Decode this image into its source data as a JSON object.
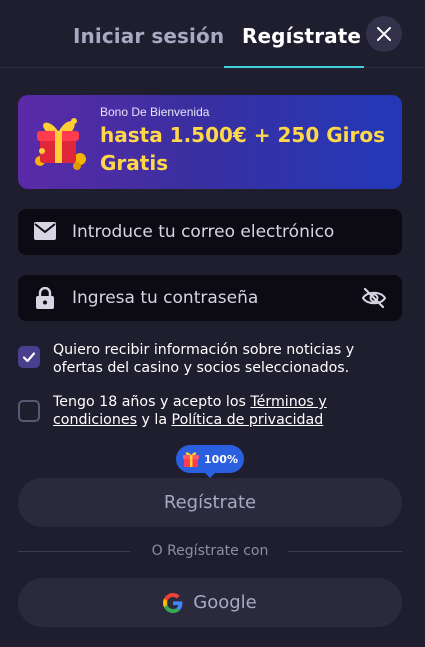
{
  "tabs": {
    "login_label": "Iniciar sesión",
    "register_label": "Regístrate",
    "active": "register"
  },
  "bonus": {
    "subtitle": "Bono De Bienvenida",
    "title": "hasta 1.500€ + 250 Giros Gratis",
    "icon": "gift-icon"
  },
  "form": {
    "email": {
      "placeholder": "Introduce tu correo electrónico",
      "value": "",
      "icon": "envelope-icon"
    },
    "password": {
      "placeholder": "Ingresa tu contraseña",
      "value": "",
      "icon": "lock-icon",
      "toggle_icon": "eye-off-icon"
    }
  },
  "consents": {
    "marketing": {
      "checked": true,
      "text": "Quiero recibir información sobre noticias y ofertas del casino y socios seleccionados."
    },
    "terms": {
      "checked": false,
      "text_before": "Tengo 18 años y acepto los ",
      "terms_link": "Términos y condiciones",
      "text_middle": " y la ",
      "privacy_link": "Política de privacidad"
    }
  },
  "badge": {
    "text": "100%",
    "icon": "gift-icon"
  },
  "register_button": {
    "label": "Regístrate"
  },
  "divider": {
    "text": "O Regístrate con"
  },
  "google_button": {
    "label": "Google",
    "icon": "google-icon"
  },
  "colors": {
    "background": "#1f1e2e",
    "accent_underline": "#3fd0dd",
    "bonus_title": "#ffd84a",
    "badge": "#2a5fe0",
    "checkbox_checked": "#4a3f8e"
  }
}
